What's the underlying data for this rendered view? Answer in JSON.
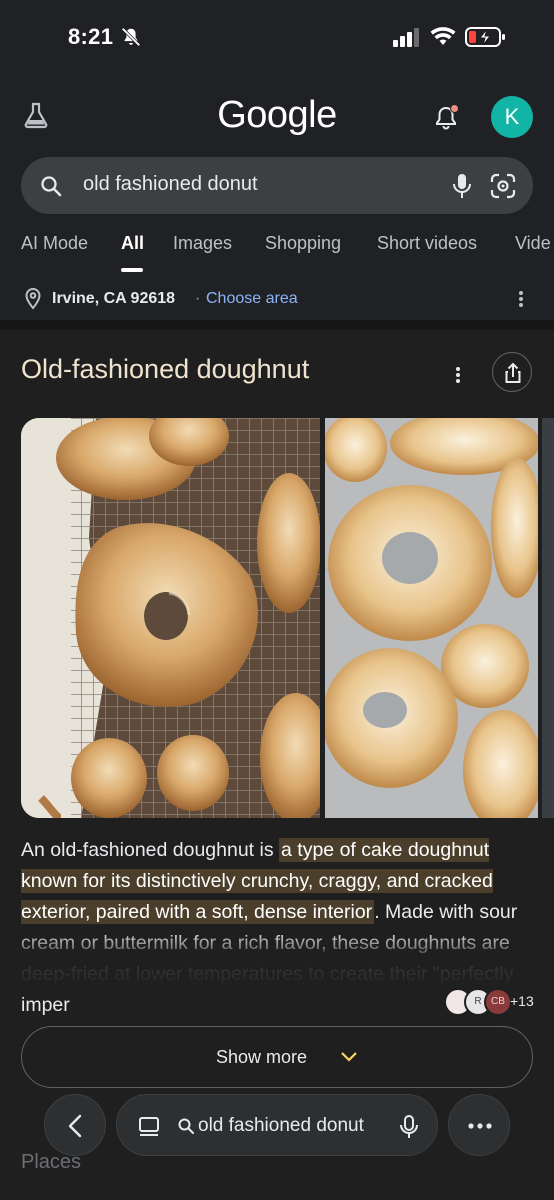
{
  "status_bar": {
    "time": "8:21",
    "icons": [
      "bell-muted-icon",
      "signal-icon",
      "wifi-icon",
      "battery-charging-icon"
    ]
  },
  "app_bar": {
    "logo": "Google",
    "avatar_initial": "K",
    "icons": [
      "labs-flask-icon",
      "notifications-icon"
    ]
  },
  "search": {
    "query": "old fashioned donut"
  },
  "tabs": [
    {
      "label": "AI Mode",
      "active": false
    },
    {
      "label": "All",
      "active": true
    },
    {
      "label": "Images",
      "active": false
    },
    {
      "label": "Shopping",
      "active": false
    },
    {
      "label": "Short videos",
      "active": false
    },
    {
      "label": "Vide",
      "active": false
    }
  ],
  "location": {
    "city": "Irvine, CA 92618",
    "separator": "·",
    "choose_area": "Choose area"
  },
  "knowledge_panel": {
    "title": "Old-fashioned doughnut",
    "description": {
      "prefix": "An old-fashioned doughnut is ",
      "highlight": "a type of cake doughnut known for its distinctively crunchy, craggy, and cracked exterior, paired with a soft, dense interior",
      "suffix": ". Made with sour cream or buttermilk for a rich flavor, these doughnuts are deep-fried at lower temperatures to create their \"perfectly imper"
    },
    "sources": {
      "faces": [
        "",
        "R",
        "CB"
      ],
      "count": "+13"
    },
    "show_more": "Show more"
  },
  "next_section": {
    "title": "Places"
  },
  "bottom_bar": {
    "query": "old fashioned donut"
  },
  "colors": {
    "background": "#1f1f1f",
    "accent_link": "#8ab4f8",
    "avatar": "#12b5a5",
    "highlight": "#4b3f2b",
    "title": "#f1e4cf"
  }
}
